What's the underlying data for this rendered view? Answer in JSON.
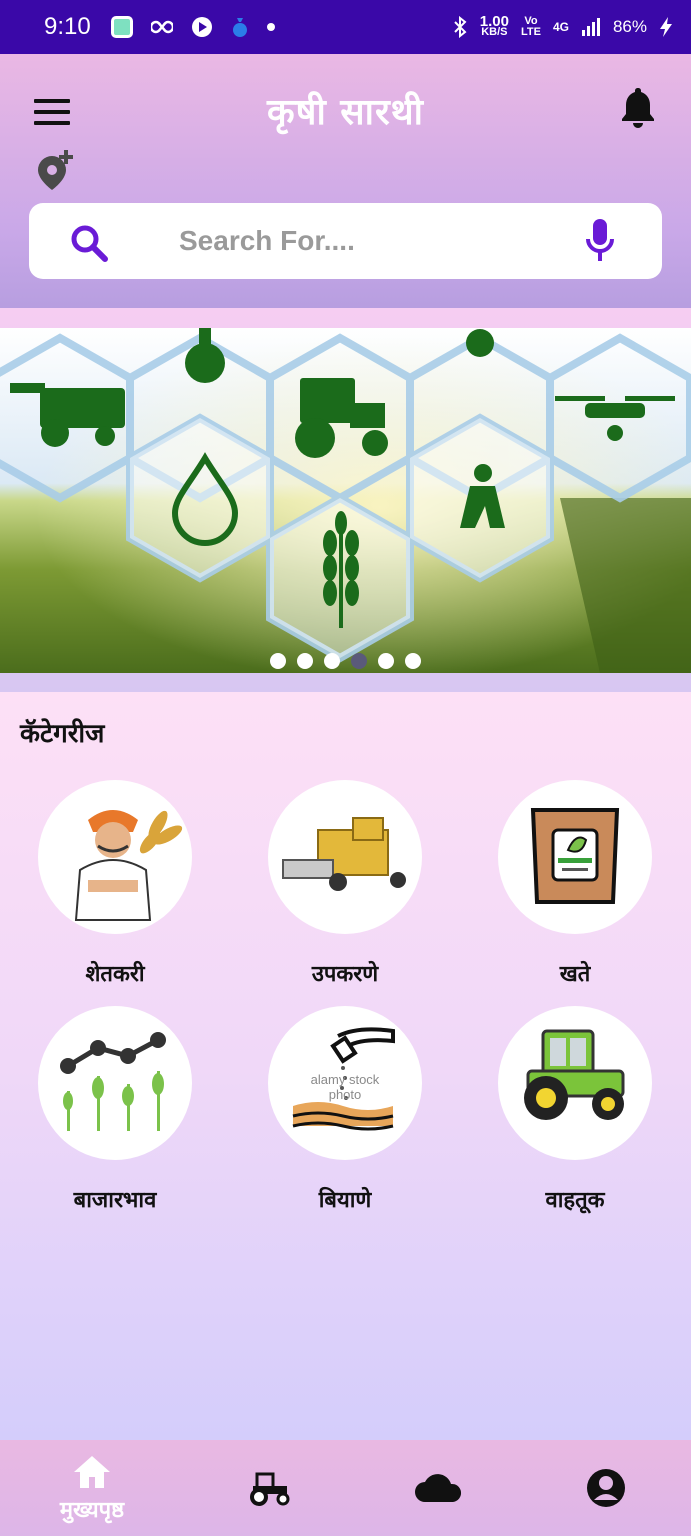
{
  "status_bar": {
    "time": "9:10",
    "speed_value": "1.00",
    "speed_unit": "KB/S",
    "volte_top": "Vo",
    "volte_bottom": "LTE",
    "network": "4G",
    "battery": "86%"
  },
  "header": {
    "title": "कृषी सारथी"
  },
  "search": {
    "placeholder": "Search For...."
  },
  "banner": {
    "slide_count": 6,
    "active_slide": 4
  },
  "categories": {
    "heading": "कॅटेगरीज",
    "items": [
      {
        "label": "शेतकरी",
        "icon": "farmer-icon"
      },
      {
        "label": "उपकरणे",
        "icon": "harvester-icon"
      },
      {
        "label": "खते",
        "icon": "fertilizer-bag-icon"
      },
      {
        "label": "बाजारभाव",
        "icon": "market-price-icon"
      },
      {
        "label": "बियाणे",
        "icon": "seeds-icon"
      },
      {
        "label": "वाहतूक",
        "icon": "tractor-icon"
      }
    ],
    "seeds_watermark": "alamy stock photo"
  },
  "bottom_nav": {
    "items": [
      {
        "label": "मुख्यपृष्ठ",
        "icon": "home-icon"
      },
      {
        "label": "",
        "icon": "tractor-icon"
      },
      {
        "label": "",
        "icon": "cloud-icon"
      },
      {
        "label": "",
        "icon": "account-icon"
      }
    ]
  },
  "colors": {
    "status_bar": "#3a08a8",
    "accent": "#6a1bd6",
    "title_text": "#ffffff"
  }
}
